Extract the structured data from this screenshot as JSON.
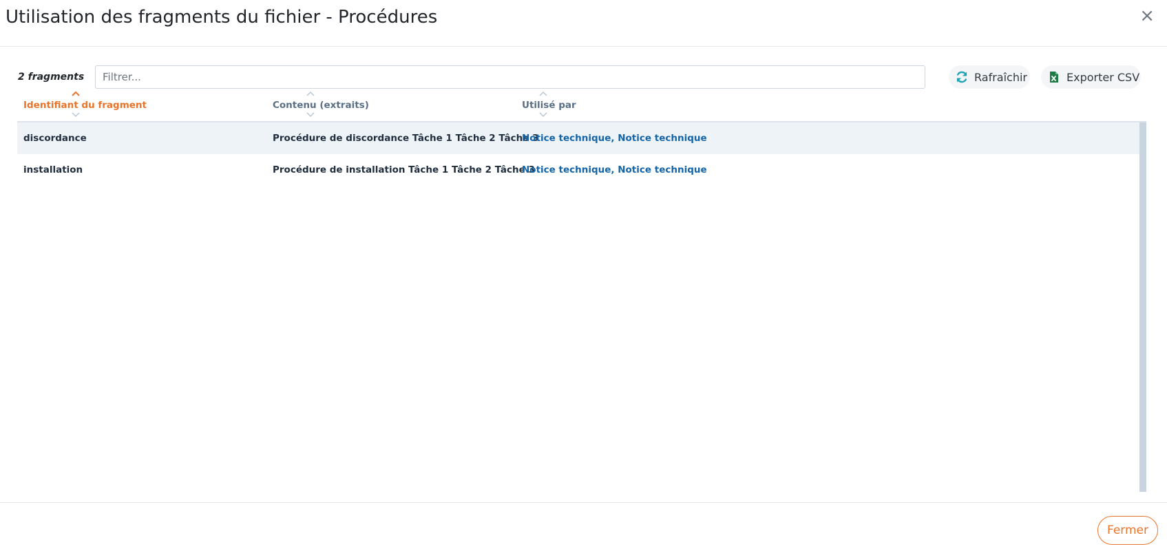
{
  "modal": {
    "title": "Utilisation des fragments du fichier - Procédures",
    "close_glyph": "×"
  },
  "toolbar": {
    "count_label": "2 fragments",
    "filter_placeholder": "Filtrer...",
    "filter_value": "",
    "refresh_label": "Rafraîchir",
    "refresh_icon": "refresh-icon",
    "export_label": "Exporter CSV",
    "export_icon": "excel-file-icon"
  },
  "table": {
    "sorted_column": "identifier",
    "columns": [
      {
        "key": "identifier",
        "label": "Identifiant du fragment",
        "sort_direction": "ascending"
      },
      {
        "key": "content",
        "label": "Contenu (extraits)",
        "sort_direction": "none"
      },
      {
        "key": "used_by",
        "label": "Utilisé par",
        "sort_direction": "none"
      }
    ],
    "rows": [
      {
        "identifier": "discordance",
        "content": "Procédure de discordance Tâche 1 Tâche 2 Tâche 3",
        "used_by": "Notice technique, Notice technique",
        "selected": true
      },
      {
        "identifier": "installation",
        "content": "Procédure de installation Tâche 1 Tâche 2 Tâche 3",
        "used_by": "Notice technique, Notice technique",
        "selected": false
      }
    ]
  },
  "footer": {
    "close_label": "Fermer"
  },
  "colors": {
    "accent": "#e8742a",
    "link": "#1464a8",
    "header_text": "#5a6f85",
    "sort_icon_inactive": "#b8c7d6",
    "selected_row": "#eef3f7",
    "refresh_icon": "#1aa3b5",
    "excel_icon": "#1e7b45"
  }
}
